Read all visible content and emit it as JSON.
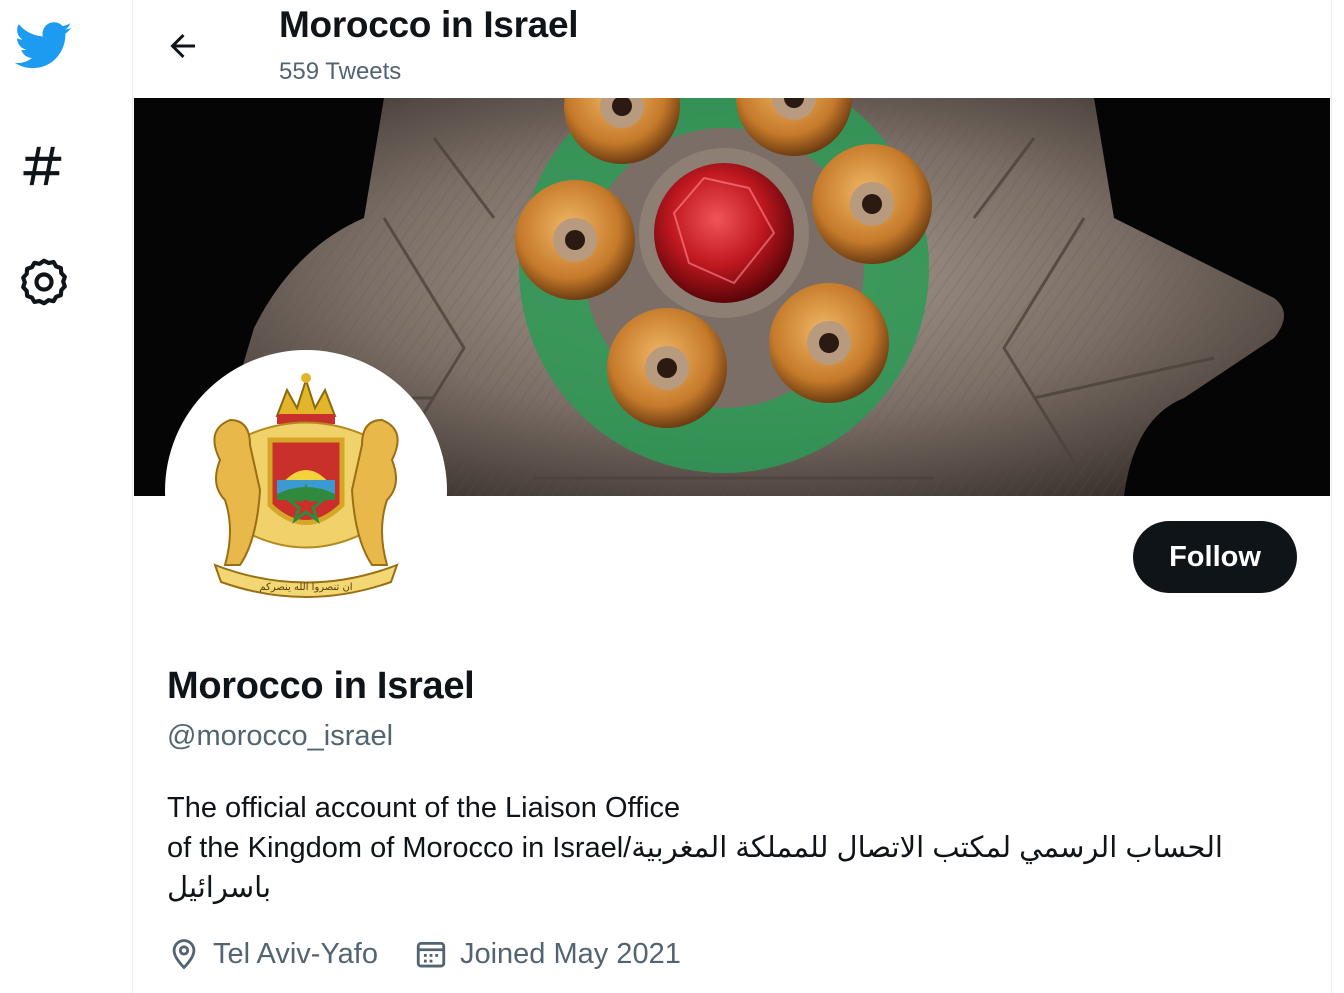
{
  "header": {
    "title": "Morocco in Israel",
    "tweet_count": "559 Tweets"
  },
  "nav": {
    "items": [
      {
        "icon": "twitter-bird-icon",
        "color": "#1d9bf0"
      },
      {
        "icon": "hashtag-icon"
      },
      {
        "icon": "gear-icon"
      }
    ]
  },
  "profile": {
    "name": "Morocco in Israel",
    "handle": "@morocco_israel",
    "bio_line1": "The official account of the Liaison Office",
    "bio_line2": "of the Kingdom of Morocco in Israel/الحساب الرسمي لمكتب الاتصال للمملكة المغربية",
    "bio_line3": "باسرائيل",
    "location": "Tel Aviv-Yafo",
    "joined": "Joined May 2021",
    "follow_label": "Follow",
    "avatar_inscription": "ان تنصروا الله ينصركم"
  },
  "colors": {
    "accent": "#1d9bf0",
    "text_primary": "#0f1419",
    "text_secondary": "#536471",
    "follow_bg": "#0f1419"
  }
}
